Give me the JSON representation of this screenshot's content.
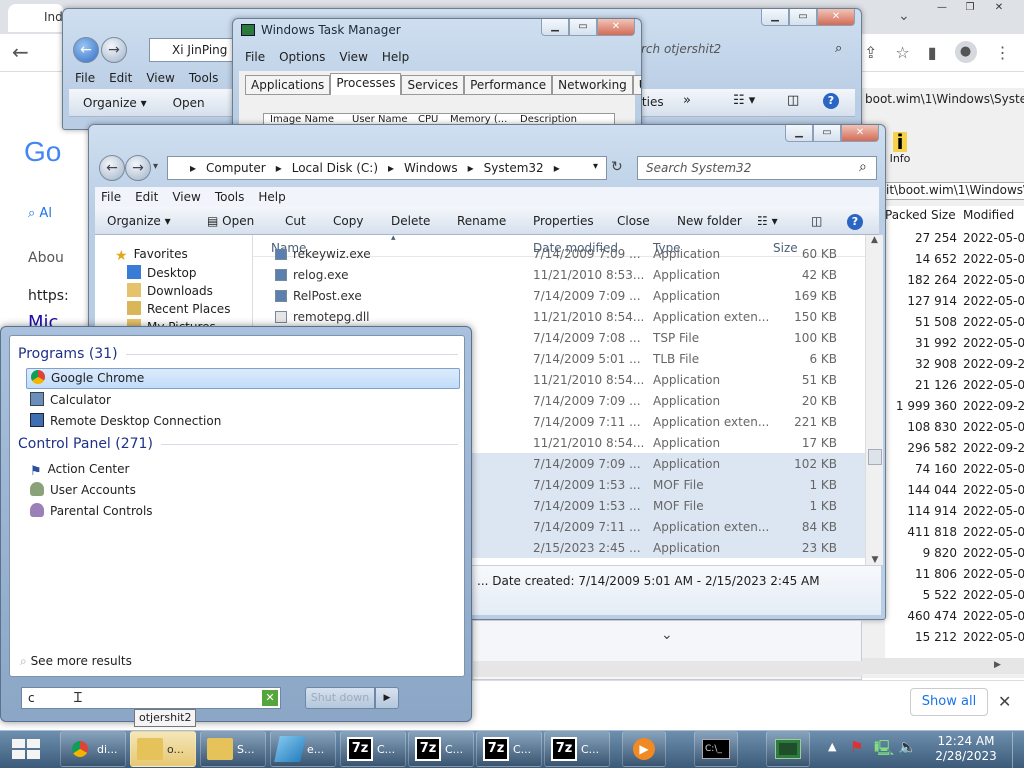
{
  "chrome": {
    "tab_title": "Ind",
    "search_tab": "Al",
    "about": "Abou",
    "https": "https:",
    "mid": "Mic",
    "logo": "Go",
    "show_all": "Show all"
  },
  "explorer_back": {
    "title": "",
    "address": "Xi JinPing",
    "search_placeholder": "rch otjershit2",
    "menu": [
      "File",
      "Edit",
      "View",
      "Tools"
    ],
    "organize": "Organize",
    "open": "Open",
    "properties_frag": "rties"
  },
  "task_manager": {
    "title": "Windows Task Manager",
    "menu": [
      "File",
      "Options",
      "View",
      "Help"
    ],
    "tabs": [
      "Applications",
      "Processes",
      "Services",
      "Performance",
      "Networking",
      "Users"
    ],
    "active_tab": "Processes",
    "cols": [
      "Image Name",
      "User Name",
      "CPU",
      "Memory (...",
      "Description"
    ]
  },
  "sevenzip": {
    "path": "boot.wim\\1\\Windows\\System",
    "path2": "it\\boot.wim\\1\\Windows\\S",
    "info": "Info",
    "col_packed": "Packed Size",
    "col_modified": "Modified",
    "rows": [
      [
        "27 254",
        "2022-05-0"
      ],
      [
        "14 652",
        "2022-05-0"
      ],
      [
        "182 264",
        "2022-05-0"
      ],
      [
        "127 914",
        "2022-05-0"
      ],
      [
        "51 508",
        "2022-05-0"
      ],
      [
        "31 992",
        "2022-05-0"
      ],
      [
        "32 908",
        "2022-09-2"
      ],
      [
        "21 126",
        "2022-05-0"
      ],
      [
        "1 999 360",
        "2022-09-2"
      ],
      [
        "108 830",
        "2022-05-0"
      ],
      [
        "296 582",
        "2022-09-2"
      ],
      [
        "74 160",
        "2022-05-0"
      ],
      [
        "144 044",
        "2022-05-0"
      ],
      [
        "114 914",
        "2022-05-0"
      ],
      [
        "411 818",
        "2022-05-0"
      ],
      [
        "9 820",
        "2022-05-0"
      ],
      [
        "11 806",
        "2022-05-0"
      ],
      [
        "5 522",
        "2022-05-0"
      ],
      [
        "460 474",
        "2022-05-0"
      ],
      [
        "15 212",
        "2022-05-0"
      ]
    ]
  },
  "explorer": {
    "breadcrumb": [
      "Computer",
      "Local Disk (C:)",
      "Windows",
      "System32"
    ],
    "search_placeholder": "Search System32",
    "menu": [
      "File",
      "Edit",
      "View",
      "Tools",
      "Help"
    ],
    "commands": [
      "Organize",
      "Open",
      "Cut",
      "Copy",
      "Delete",
      "Rename",
      "Properties",
      "Close",
      "New folder"
    ],
    "nav": [
      "Favorites",
      "Desktop",
      "Downloads",
      "Recent Places",
      "My Pictures"
    ],
    "columns": [
      "Name",
      "Date modified",
      "Type",
      "Size"
    ],
    "files": [
      [
        "rekeywiz.exe",
        "7/14/2009 7:09 ...",
        "Application",
        "60 KB"
      ],
      [
        "relog.exe",
        "11/21/2010 8:53...",
        "Application",
        "42 KB"
      ],
      [
        "RelPost.exe",
        "7/14/2009 7:09 ...",
        "Application",
        "169 KB"
      ],
      [
        "remotepg.dll",
        "11/21/2010 8:54...",
        "Application exten...",
        "150 KB"
      ],
      [
        "",
        "7/14/2009 7:08 ...",
        "TSP File",
        "100 KB"
      ],
      [
        "",
        "7/14/2009 5:01 ...",
        "TLB File",
        "6 KB"
      ],
      [
        "",
        "11/21/2010 8:54...",
        "Application",
        "51 KB"
      ],
      [
        "",
        "7/14/2009 7:09 ...",
        "Application",
        "20 KB"
      ],
      [
        "",
        "7/14/2009 7:11 ...",
        "Application exten...",
        "221 KB"
      ],
      [
        "",
        "11/21/2010 8:54...",
        "Application",
        "17 KB"
      ],
      [
        "",
        "7/14/2009 7:09 ...",
        "Application",
        "102 KB"
      ],
      [
        "",
        "7/14/2009 1:53 ...",
        "MOF File",
        "1 KB"
      ],
      [
        "",
        "7/14/2009 1:53 ...",
        "MOF File",
        "1 KB"
      ],
      [
        "",
        "7/14/2009 7:11 ...",
        "Application exten...",
        "84 KB"
      ],
      [
        "",
        "2/15/2023 2:45 ...",
        "Application",
        "23 KB"
      ]
    ],
    "status": "... Date created: 7/14/2009 5:01 AM - 2/15/2023 2:45 AM"
  },
  "start_menu": {
    "programs_header": "Programs (31)",
    "programs": [
      "Google Chrome",
      "Calculator",
      "Remote Desktop Connection"
    ],
    "control_header": "Control Panel (271)",
    "control": [
      "Action Center",
      "User Accounts",
      "Parental Controls"
    ],
    "see_more": "See more results",
    "search_value": "c",
    "shutdown": "Shut down",
    "tooltip": "otjershit2"
  },
  "taskbar": {
    "items": [
      {
        "icon": "chrome",
        "label": "di..."
      },
      {
        "icon": "folder",
        "label": "o..."
      },
      {
        "icon": "folder",
        "label": "S..."
      },
      {
        "icon": "app",
        "label": "e..."
      },
      {
        "icon": "7z",
        "label": "C..."
      },
      {
        "icon": "7z",
        "label": "C..."
      },
      {
        "icon": "7z",
        "label": "C..."
      },
      {
        "icon": "7z",
        "label": "C..."
      }
    ],
    "time": "12:24 AM",
    "date": "2/28/2023"
  }
}
